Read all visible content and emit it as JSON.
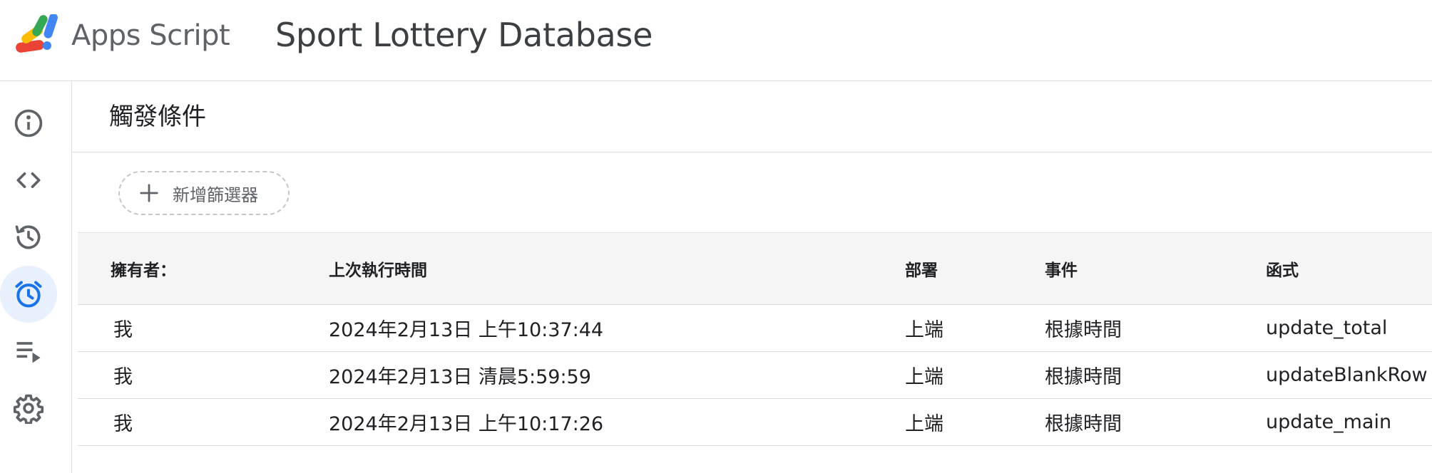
{
  "header": {
    "product_name": "Apps Script",
    "project_title": "Sport Lottery Database"
  },
  "sidebar": {
    "items": [
      {
        "name": "overview",
        "icon": "info-icon",
        "active": false
      },
      {
        "name": "editor",
        "icon": "code-icon",
        "active": false
      },
      {
        "name": "project-history",
        "icon": "history-icon",
        "active": false
      },
      {
        "name": "triggers",
        "icon": "alarm-clock-icon",
        "active": true
      },
      {
        "name": "executions",
        "icon": "playlist-play-icon",
        "active": false
      },
      {
        "name": "project-settings",
        "icon": "gear-icon",
        "active": false
      }
    ]
  },
  "main": {
    "title": "觸發條件",
    "add_filter_label": "新增篩選器"
  },
  "table": {
    "headers": {
      "owner": "擁有者：",
      "last_run": "上次執行時間",
      "deployment": "部署",
      "event": "事件",
      "function": "函式"
    },
    "rows": [
      {
        "owner": "我",
        "last_run": "2024年2月13日 上午10:37:44",
        "deployment": "上端",
        "event": "根據時間",
        "function": "update_total"
      },
      {
        "owner": "我",
        "last_run": "2024年2月13日 清晨5:59:59",
        "deployment": "上端",
        "event": "根據時間",
        "function": "updateBlankRow"
      },
      {
        "owner": "我",
        "last_run": "2024年2月13日 上午10:17:26",
        "deployment": "上端",
        "event": "根據時間",
        "function": "update_main"
      }
    ]
  },
  "colors": {
    "accent": "#1a73e8",
    "active_bg": "#e8f0fe",
    "icon_gray": "#5f6368",
    "logo_red": "#ea4335",
    "logo_yellow": "#fbbc04",
    "logo_green": "#34a853",
    "logo_blue": "#4285f4"
  }
}
